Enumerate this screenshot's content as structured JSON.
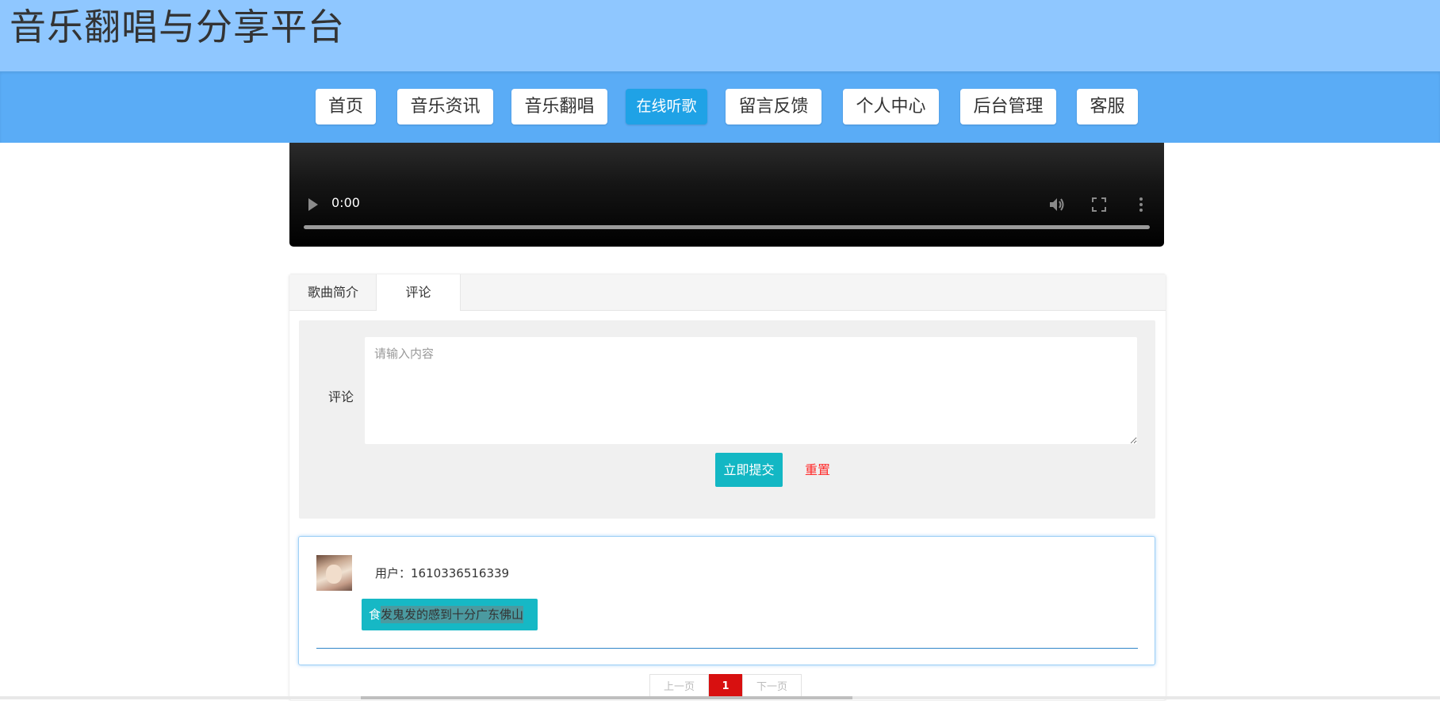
{
  "header": {
    "title": "音乐翻唱与分享平台"
  },
  "nav": {
    "items": [
      {
        "label": "首页"
      },
      {
        "label": "音乐资讯"
      },
      {
        "label": "音乐翻唱"
      },
      {
        "label": "在线听歌",
        "active": true
      },
      {
        "label": "留言反馈"
      },
      {
        "label": "个人中心"
      },
      {
        "label": "后台管理"
      },
      {
        "label": "客服"
      }
    ]
  },
  "player": {
    "time": "0:00"
  },
  "tabs": [
    {
      "label": "歌曲简介"
    },
    {
      "label": "评论",
      "active": true
    }
  ],
  "comment_form": {
    "label": "评论",
    "placeholder": "请输入内容",
    "value": "",
    "submit_label": "立即提交",
    "reset_label": "重置"
  },
  "comments": [
    {
      "user_prefix": "用户：",
      "user": "1610336516339",
      "content_first": "食",
      "content_rest": "发鬼发的感到十分广东佛山"
    }
  ],
  "pagination": {
    "prev_label": "上一页",
    "current_page": "1",
    "next_label": "下一页"
  },
  "colors": {
    "header_bg": "#8fc7ff",
    "nav_bg": "#5aacf6",
    "nav_active": "#1fa2e6",
    "submit_bg": "#13b7c4",
    "reset_text": "#ff2a2a",
    "pager_current": "#d81010"
  }
}
